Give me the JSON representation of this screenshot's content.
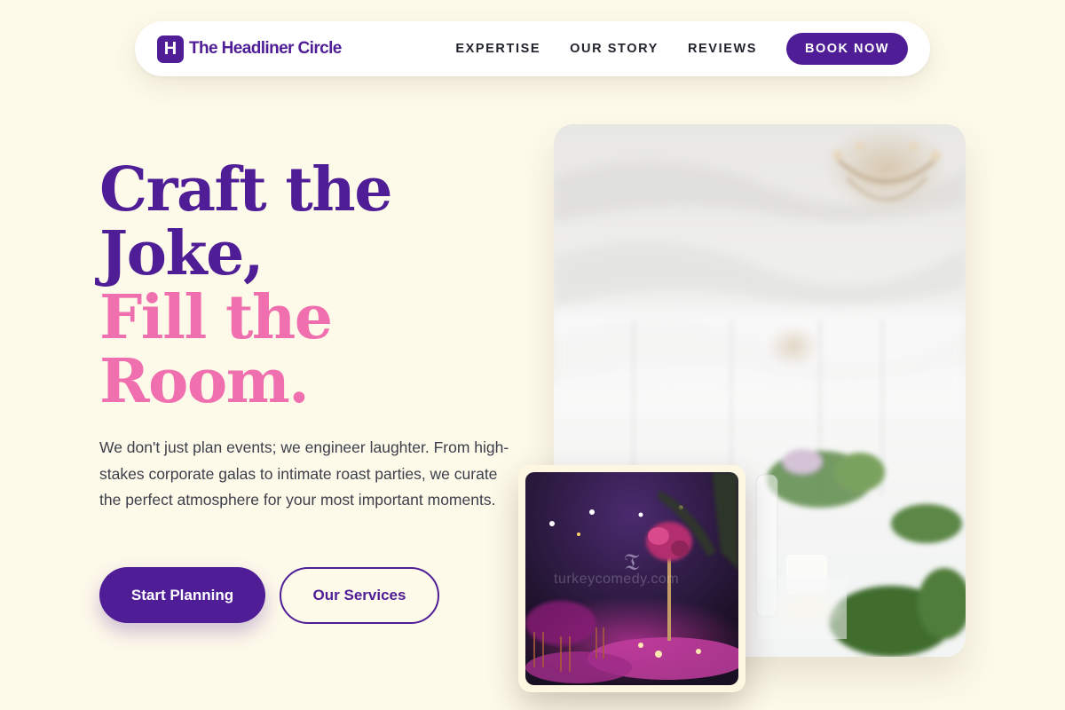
{
  "brand": {
    "mark": "H",
    "name": "The Headliner Circle"
  },
  "nav": {
    "links": [
      "EXPERTISE",
      "OUR STORY",
      "REVIEWS"
    ],
    "cta": "BOOK NOW"
  },
  "hero": {
    "headline_line1": "Craft the",
    "headline_line2": "Joke,",
    "headline_line3": "Fill the",
    "headline_line4": "Room.",
    "description": "We don't just plan events; we engineer laughter. From high-stakes corporate galas to intimate roast parties, we curate the perfect atmosphere for your most important moments.",
    "primary_button": "Start Planning",
    "secondary_button": "Our Services"
  },
  "images": {
    "main_watermark": "turkeycomedy.com",
    "small_watermark": "turkeycomedy.com"
  },
  "colors": {
    "background": "#fefaea",
    "brand_purple": "#4f1d96",
    "accent_pink": "#f06fae",
    "body_text": "#3c3f4a"
  }
}
